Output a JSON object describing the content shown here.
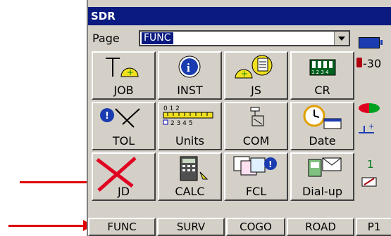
{
  "window": {
    "title": "SDR"
  },
  "page": {
    "label": "Page",
    "value": "FUNC"
  },
  "tiles": [
    {
      "label": "JOB",
      "icon": "job-icon"
    },
    {
      "label": "INST",
      "icon": "info-icon"
    },
    {
      "label": "JS",
      "icon": "job-settings-icon"
    },
    {
      "label": "CR",
      "icon": "card-reader-icon"
    },
    {
      "label": "TOL",
      "icon": "tolerance-icon"
    },
    {
      "label": "Units",
      "icon": "ruler-icon"
    },
    {
      "label": "COM",
      "icon": "communication-icon"
    },
    {
      "label": "Date",
      "icon": "clock-calendar-icon"
    },
    {
      "label": "JD",
      "icon": "delete-job-icon"
    },
    {
      "label": "CALC",
      "icon": "calculator-icon"
    },
    {
      "label": "FCL",
      "icon": "feature-code-list-icon"
    },
    {
      "label": "Dial-up",
      "icon": "dial-up-icon"
    }
  ],
  "status": {
    "temperature": "-30"
  },
  "side_indicator": {
    "value": "1"
  },
  "tabs": [
    "FUNC",
    "SURV",
    "COGO",
    "ROAD",
    "P1"
  ],
  "colors": {
    "title_bg": "#0a1a80",
    "accent_arrow": "#e00000"
  }
}
